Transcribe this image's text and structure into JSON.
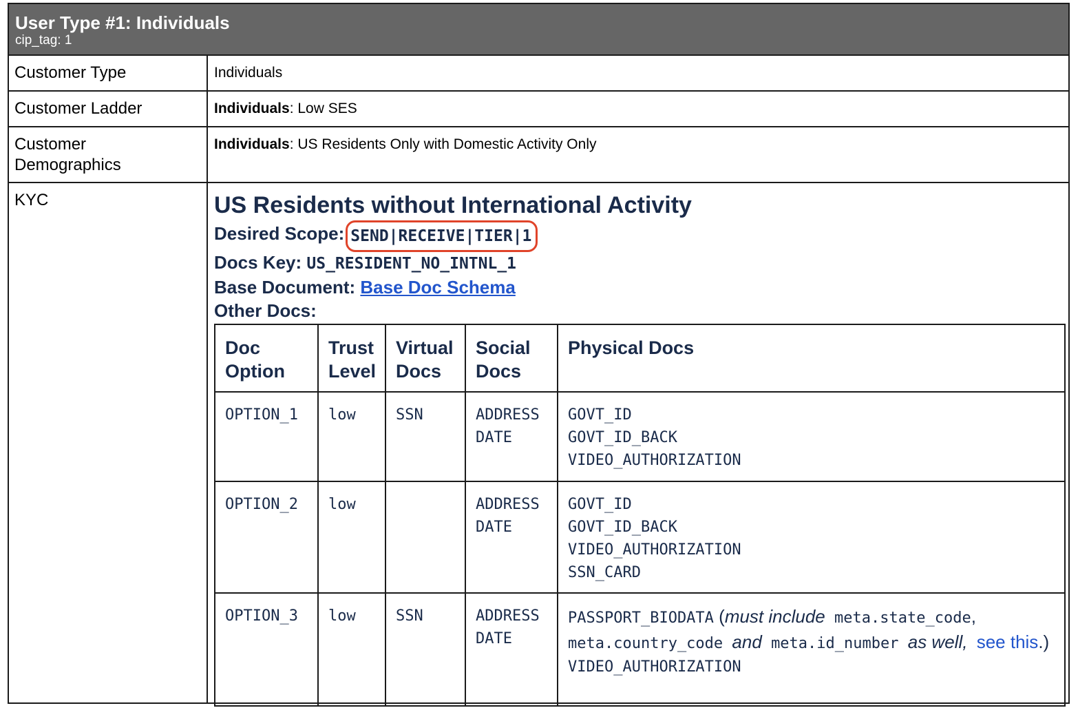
{
  "header": {
    "title": "User Type #1: Individuals",
    "subtitle": "cip_tag: 1"
  },
  "rows": {
    "customer_type": {
      "label": "Customer Type",
      "value": "Individuals"
    },
    "customer_ladder": {
      "label": "Customer Ladder",
      "bold": "Individuals",
      "rest": ": Low SES"
    },
    "customer_demographics": {
      "label": "Customer Demographics",
      "bold": "Individuals",
      "rest": ": US Residents Only with Domestic Activity Only"
    },
    "kyc": {
      "label": "KYC"
    }
  },
  "kyc": {
    "heading": "US Residents without International Activity",
    "desired_scope_label": "Desired Scope:",
    "desired_scope_value": "SEND|RECEIVE|TIER|1",
    "docs_key_label": "Docs Key:",
    "docs_key_value": "US_RESIDENT_NO_INTNL_1",
    "base_document_label": "Base Document:",
    "base_document_link": "Base Doc Schema",
    "other_docs_label": "Other Docs:"
  },
  "docs_table": {
    "headers": [
      "Doc Option",
      "Trust Level",
      "Virtual Docs",
      "Social Docs",
      "Physical Docs"
    ],
    "rows": [
      {
        "option": "OPTION_1",
        "trust": "low",
        "virtual": "SSN",
        "social": [
          "ADDRESS",
          "DATE"
        ],
        "physical": [
          "GOVT_ID",
          "GOVT_ID_BACK",
          "VIDEO_AUTHORIZATION"
        ]
      },
      {
        "option": "OPTION_2",
        "trust": "low",
        "virtual": "",
        "social": [
          "ADDRESS",
          "DATE"
        ],
        "physical": [
          "GOVT_ID",
          "GOVT_ID_BACK",
          "VIDEO_AUTHORIZATION",
          "SSN_CARD"
        ]
      },
      {
        "option": "OPTION_3",
        "trust": "low",
        "virtual": "SSN",
        "social": [
          "ADDRESS",
          "DATE"
        ],
        "physical_note": {
          "doc": "PASSPORT_BIODATA",
          "open": " (",
          "must_include": "must include",
          "code1": "meta.state_code",
          "comma": ",",
          "code2": "meta.country_code",
          "and": "and",
          "code3": "meta.id_number",
          "as_well": "as well,",
          "see_this": "see this",
          "close": ".)"
        },
        "physical_after": [
          "VIDEO_AUTHORIZATION"
        ]
      }
    ]
  },
  "colors": {
    "header_bg": "#666666",
    "heading_text": "#1a2b4a",
    "highlight_border": "#e0442a",
    "link": "#2255cc"
  }
}
